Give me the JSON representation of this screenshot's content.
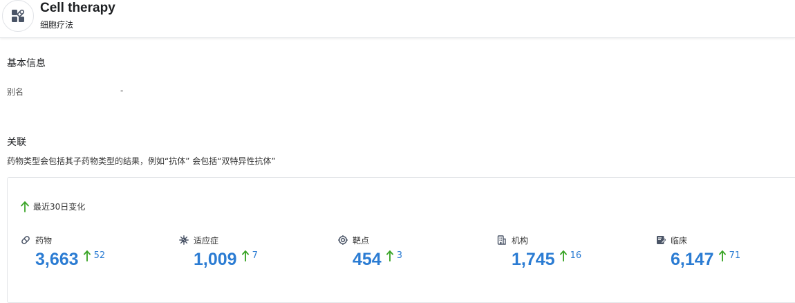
{
  "header": {
    "title": "Cell therapy",
    "subtitle": "细胞疗法",
    "logo_icon": "pill-edit-icon"
  },
  "basic_info": {
    "section_title": "基本信息",
    "alias_label": "别名",
    "alias_value": "-"
  },
  "relations": {
    "section_title": "关联",
    "note": "药物类型会包括其子药物类型的结果，例如“抗体” 会包括“双特异性抗体”",
    "change_label": "最近30日变化",
    "stats": [
      {
        "label": "药物",
        "value": "3,663",
        "delta": "52",
        "icon": "pill-icon"
      },
      {
        "label": "适应症",
        "value": "1,009",
        "delta": "7",
        "icon": "virus-icon"
      },
      {
        "label": "靶点",
        "value": "454",
        "delta": "3",
        "icon": "target-icon"
      },
      {
        "label": "机构",
        "value": "1,745",
        "delta": "16",
        "icon": "building-icon"
      },
      {
        "label": "临床",
        "value": "6,147",
        "delta": "71",
        "icon": "clipboard-edit-icon"
      }
    ]
  },
  "colors": {
    "accent_blue": "#2b7cd3",
    "up_green": "#3ba528",
    "icon_dark": "#4a5466"
  }
}
